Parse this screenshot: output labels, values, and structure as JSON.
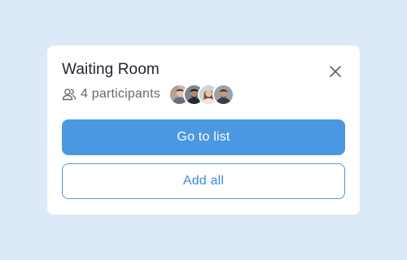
{
  "dialog": {
    "title": "Waiting Room",
    "participants_label": "4 participants",
    "participant_count": 4,
    "primary_button_label": "Go to list",
    "secondary_button_label": "Add all"
  },
  "colors": {
    "background": "#dceaf8",
    "card": "#ffffff",
    "accent": "#4a97e2",
    "title_text": "#1e2430",
    "muted_text": "#626a75"
  },
  "icons": {
    "close": "close-icon",
    "participants": "people-icon"
  }
}
